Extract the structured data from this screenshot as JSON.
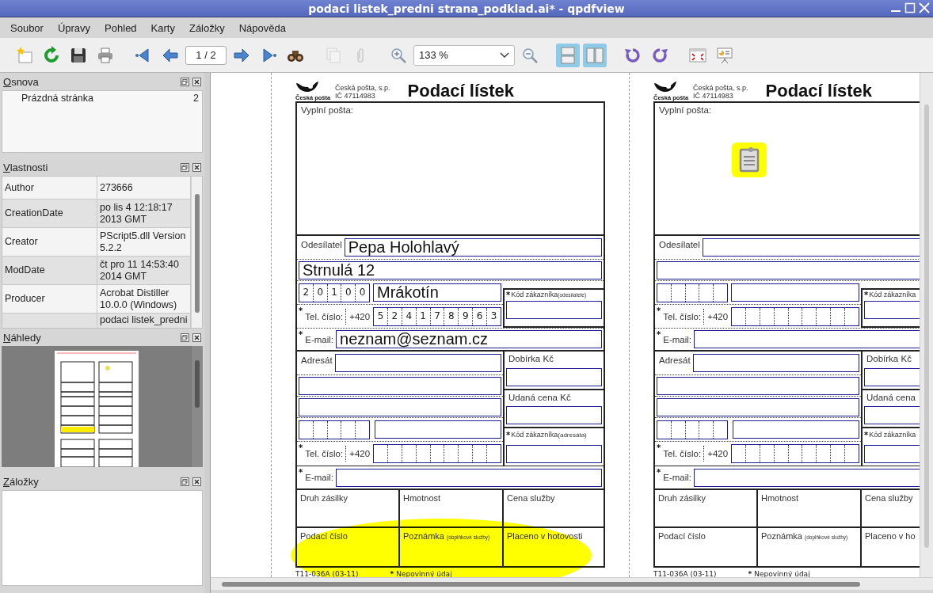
{
  "window": {
    "title": "podaci listek_predni strana_podklad.ai* - qpdfview"
  },
  "menu": [
    "Soubor",
    "Úpravy",
    "Pohled",
    "Karty",
    "Záložky",
    "Nápověda"
  ],
  "toolbar": {
    "groups": [
      {
        "items": [
          {
            "kind": "new"
          },
          {
            "kind": "reload"
          },
          {
            "kind": "save"
          },
          {
            "kind": "print"
          }
        ]
      },
      {
        "items": [
          {
            "kind": "first"
          },
          {
            "kind": "prev"
          },
          {
            "kind": "page",
            "value": "1 / 2"
          },
          {
            "kind": "next"
          },
          {
            "kind": "last"
          },
          {
            "kind": "find"
          }
        ]
      },
      {
        "items": [
          {
            "kind": "copy",
            "disabled": true
          },
          {
            "kind": "attach",
            "disabled": true
          }
        ]
      },
      {
        "items": [
          {
            "kind": "zoomin"
          },
          {
            "kind": "zoom",
            "value": "133 %"
          },
          {
            "kind": "zoomout"
          }
        ]
      },
      {
        "items": [
          {
            "kind": "continuous",
            "checked": true
          },
          {
            "kind": "twopage",
            "checked": true
          }
        ]
      },
      {
        "items": [
          {
            "kind": "rotleft"
          },
          {
            "kind": "rotright"
          }
        ]
      },
      {
        "items": [
          {
            "kind": "fullscreen"
          },
          {
            "kind": "presentation"
          }
        ]
      }
    ]
  },
  "outline": {
    "title": "Osnova",
    "items": [
      {
        "title": "Prázdná stránka",
        "page": "2"
      }
    ]
  },
  "properties": {
    "title": "Vlastnosti",
    "rows": [
      {
        "key": "Author",
        "value": "273666"
      },
      {
        "key": "CreationDate",
        "value": "po lis 4 12:18:17 2013 GMT"
      },
      {
        "key": "Creator",
        "value": "PScript5.dll Version 5.2.2"
      },
      {
        "key": "ModDate",
        "value": "čt pro 11 14:53:40 2014 GMT"
      },
      {
        "key": "Producer",
        "value": "Acrobat Distiller 10.0.0 (Windows)"
      },
      {
        "value": "podaci listek_predni"
      }
    ]
  },
  "thumbnails": {
    "title": "Náhledy"
  },
  "bookmarks": {
    "title": "Záložky"
  },
  "pages": [
    {
      "header": {
        "logo_caption": "Česká pošta",
        "org": "Česká pošta, s.p.",
        "ic": "IČ 47114983",
        "title": "Podací lístek"
      },
      "post_label": "Vyplní pošta:",
      "highlight": true,
      "note": false,
      "sender": {
        "label": "Odesílatel",
        "name": "Pepa Holohlavý",
        "street": "Strnulá 12",
        "zip": [
          "2",
          "0",
          "1",
          "0",
          "0"
        ],
        "city": "Mrákotín",
        "tel_mark": "*",
        "tel_label": "Tel. číslo:",
        "prefix": "+420",
        "phone": [
          "5",
          "2",
          "4",
          "1",
          "7",
          "8",
          "9",
          "6",
          "3"
        ],
        "email_mark": "*",
        "email_label": "E-mail:",
        "email": "neznam@seznam.cz",
        "code_mark": "*",
        "code_label": "Kód zákazníka",
        "code_note": "(odesílatele)"
      },
      "recipient": {
        "label": "Adresát",
        "tel_mark": "*",
        "tel_label": "Tel. číslo:",
        "prefix": "+420",
        "email_mark": "*",
        "email_label": "E-mail:",
        "cod_label": "Dobírka Kč",
        "value_label": "Udaná cena Kč",
        "code_mark": "*",
        "code_label": "Kód zákazníka",
        "code_note": "(adresáta)"
      },
      "service": [
        {
          "label": "Druh zásilky"
        },
        {
          "label": "Hmotnost"
        },
        {
          "label": "Cena služby"
        },
        {
          "label": "Podací číslo"
        },
        {
          "label": "Poznámka",
          "note": "(doplňkové služby)"
        },
        {
          "label": "Placeno v hotovosti"
        }
      ],
      "footer": {
        "code": "T11-036A (03-11)",
        "mark": "*",
        "legend": "Nepovinný údaj"
      }
    },
    {
      "header": {
        "logo_caption": "Česká pošta",
        "org": "Česká pošta, s.p.",
        "ic": "IČ 47114983",
        "title": "Podací lístek"
      },
      "post_label": "Vyplní pošta:",
      "highlight": false,
      "note": true,
      "sender": {
        "label": "Odesílatel",
        "tel_mark": "*",
        "tel_label": "Tel. číslo:",
        "prefix": "+420",
        "email_mark": "*",
        "email_label": "E-mail:",
        "code_mark": "*",
        "code_label": "Kód zákazníka"
      },
      "recipient": {
        "label": "Adresát",
        "tel_mark": "*",
        "tel_label": "Tel. číslo:",
        "prefix": "+420",
        "email_mark": "*",
        "email_label": "E-mail:",
        "cod_label": "Dobírka Kč",
        "value_label": "Udaná cena",
        "code_mark": "*",
        "code_label": "Kód zákazníka"
      },
      "service": [
        {
          "label": "Druh zásilky"
        },
        {
          "label": "Hmotnost"
        },
        {
          "label": "Cena služby"
        },
        {
          "label": "Podací číslo"
        },
        {
          "label": "Poznámka",
          "note": "(doplňkové služby)"
        },
        {
          "label": "Placeno v ho"
        }
      ],
      "footer": {
        "code": "T11-036A (03-11)",
        "mark": "*",
        "legend": "Nepovinný údaj"
      }
    }
  ]
}
